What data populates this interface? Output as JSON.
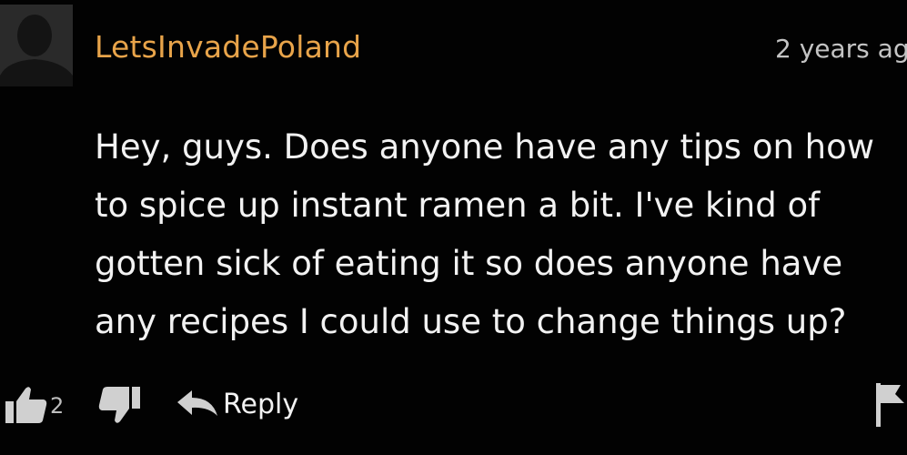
{
  "comment": {
    "author": "LetsInvadePoland",
    "timestamp": "2 years ag",
    "body_lines": [
      "Hey, guys. Does anyone have any tips on how",
      "to spice up instant ramen a bit. I've kind of",
      "gotten sick of eating it so does anyone have",
      "any recipes I could use to change things up?"
    ],
    "upvote_count": "2",
    "reply_label": "Reply"
  },
  "icons": {
    "avatar": "default-avatar-icon",
    "upvote": "thumbs-up-icon",
    "downvote": "thumbs-down-icon",
    "reply": "reply-arrow-icon",
    "flag": "flag-icon"
  },
  "colors": {
    "background": "#020202",
    "username": "#e8a44a",
    "text": "#f2f2f2",
    "muted": "#c4c4c4",
    "icon": "#d0d0d0"
  }
}
